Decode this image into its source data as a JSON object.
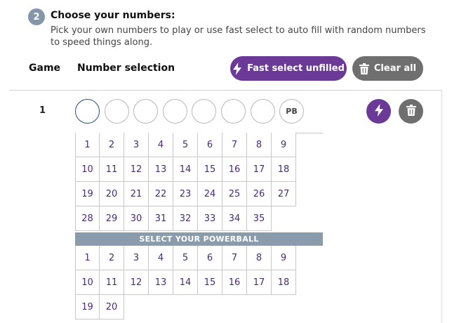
{
  "step": {
    "number": "2",
    "title": "Choose your numbers:",
    "description": "Pick your own numbers to play or use fast select to auto fill with random numbers to speed things along."
  },
  "header": {
    "game_label": "Game",
    "selection_label": "Number selection",
    "fast_select_label": "Fast select unfilled",
    "clear_all_label": "Clear all"
  },
  "game_row": {
    "index": "1",
    "powerball_ball_label": "PB"
  },
  "main_numbers": [
    "1",
    "2",
    "3",
    "4",
    "5",
    "6",
    "7",
    "8",
    "9",
    "10",
    "11",
    "12",
    "13",
    "14",
    "15",
    "16",
    "17",
    "18",
    "19",
    "20",
    "21",
    "22",
    "23",
    "24",
    "25",
    "26",
    "27",
    "28",
    "29",
    "30",
    "31",
    "32",
    "33",
    "34",
    "35"
  ],
  "powerball_heading": "SELECT YOUR POWERBALL",
  "powerball_numbers": [
    "1",
    "2",
    "3",
    "4",
    "5",
    "6",
    "7",
    "8",
    "9",
    "10",
    "11",
    "12",
    "13",
    "14",
    "15",
    "16",
    "17",
    "18",
    "19",
    "20"
  ],
  "colors": {
    "accent_purple": "#6b3a96",
    "button_grey": "#6f6f6f",
    "powerball_bar": "#8a9cab",
    "step_badge": "#8497a8"
  },
  "icons": {
    "fast_select": "lightning-icon",
    "clear": "trash-icon"
  }
}
